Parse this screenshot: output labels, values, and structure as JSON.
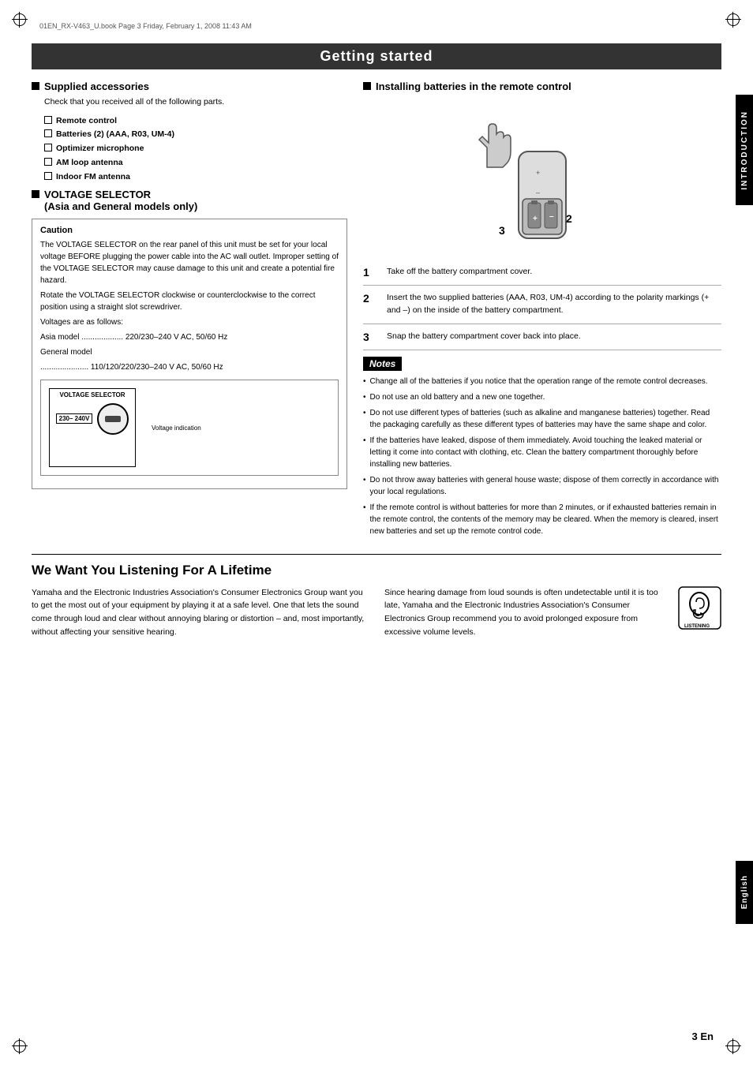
{
  "page": {
    "file_info": "01EN_RX-V463_U.book  Page 3  Friday, February 1, 2008  11:43 AM",
    "page_number": "3 En",
    "side_tab_intro": "INTRODUCTION",
    "side_tab_english": "English"
  },
  "section_title": "Getting started",
  "left_column": {
    "supplied_header": "Supplied accessories",
    "supplied_intro": "Check that you received all of the following parts.",
    "supplied_items": [
      "Remote control",
      "Batteries (2) (AAA, R03, UM-4)",
      "Optimizer microphone",
      "AM loop antenna",
      "Indoor FM antenna"
    ],
    "voltage_header": "VOLTAGE SELECTOR\n(Asia and General models only)",
    "caution": {
      "title": "Caution",
      "paragraphs": [
        "The VOLTAGE SELECTOR on the rear panel of this unit must be set for your local voltage BEFORE plugging the power cable into the AC wall outlet. Improper setting of the VOLTAGE SELECTOR may cause damage to this unit and create a potential fire hazard.",
        "Rotate the VOLTAGE SELECTOR clockwise or counterclockwise to the correct position using a straight slot screwdriver.",
        "Voltages are as follows:",
        "Asia model ...................  220/230–240 V AC, 50/60 Hz",
        "General model",
        "...................... 110/120/220/230–240 V AC, 50/60 Hz"
      ]
    },
    "voltage_diagram": {
      "selector_label": "VOLTAGE\nSELECTOR",
      "value_label": "230–\n240V",
      "indicator_label": "Voltage indication"
    }
  },
  "right_column": {
    "install_header": "Installing batteries in the remote control",
    "steps": [
      {
        "number": "1",
        "text": "Take off the battery compartment cover."
      },
      {
        "number": "2",
        "text": "Insert the two supplied batteries (AAA, R03, UM-4) according to the polarity markings (+ and –) on the inside of the battery compartment."
      },
      {
        "number": "3",
        "text": "Snap the battery compartment cover back into place."
      }
    ],
    "notes_title": "Notes",
    "notes": [
      "Change all of the batteries if you notice that the operation range of the remote control decreases.",
      "Do not use an old battery and a new one together.",
      "Do not use different types of batteries (such as alkaline and manganese batteries) together. Read the packaging carefully as these different types of batteries may have the same shape and color.",
      "If the batteries have leaked, dispose of them immediately. Avoid touching the leaked material or letting it come into contact with clothing, etc. Clean the battery compartment thoroughly before installing new batteries.",
      "Do not throw away batteries with general house waste; dispose of them correctly in accordance with your local regulations.",
      "If the remote control is without batteries for more than 2 minutes, or if exhausted batteries remain in the remote control, the contents of the memory may be cleared. When the memory is cleared, insert new batteries and set up the remote control code."
    ]
  },
  "bottom_section": {
    "title": "We Want You Listening For A Lifetime",
    "left_text": "Yamaha and the Electronic Industries Association's Consumer Electronics Group want you to get the most out of your equipment by playing it at a safe level. One that lets the sound come through loud and clear without annoying blaring or distortion – and, most importantly, without affecting your sensitive hearing.",
    "right_text": "Since hearing damage from loud sounds is often undetectable until it is too late, Yamaha and the Electronic Industries Association's Consumer Electronics Group recommend you to avoid prolonged exposure from excessive volume levels."
  }
}
